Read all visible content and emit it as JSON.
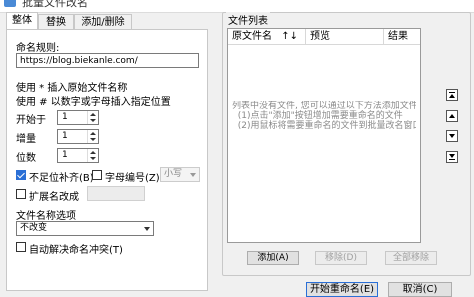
{
  "window": {
    "title": "批量文件改名"
  },
  "tabs": [
    {
      "label": "整体"
    },
    {
      "label": "替换"
    },
    {
      "label": "添加/删除"
    }
  ],
  "naming": {
    "label": "命名规则:",
    "value": "https://blog.biekanle.com/",
    "hint_star": "使用 * 插入原始文件名称",
    "hint_hash": "使用 # 以数字或字母插入指定位置"
  },
  "numbering": {
    "start_label": "开始于",
    "start_value": "1",
    "step_label": "增量",
    "step_value": "1",
    "digits_label": "位数",
    "digits_value": "1"
  },
  "options": {
    "pad_label": "不足位补齐(B)",
    "pad_checked": true,
    "letter_label": "字母编号(Z)",
    "letter_checked": false,
    "case_value": "小写",
    "ext_label": "扩展名改成",
    "ext_checked": false
  },
  "filename_opts": {
    "label": "文件名称选项",
    "value": "不改变"
  },
  "auto_resolve": {
    "label": "自动解决命名冲突(T)",
    "checked": false
  },
  "file_list": {
    "title": "文件列表",
    "col_original": "原文件名",
    "sort_icon": "↑↓",
    "col_preview": "预览",
    "col_result": "结果",
    "empty_text": "列表中没有文件, 您可以通过以下方法添加文件:\n  (1)点击\"添加\"按钮增加需要重命名的文件\n  (2)用鼠标将需要重命名的文件到批量改名窗口上",
    "add_label": "添加(A)",
    "remove_label": "移除(D)",
    "remove_all_label": "全部移除"
  },
  "footer": {
    "start_label": "开始重命名(E)",
    "cancel_label": "取消(C)"
  }
}
